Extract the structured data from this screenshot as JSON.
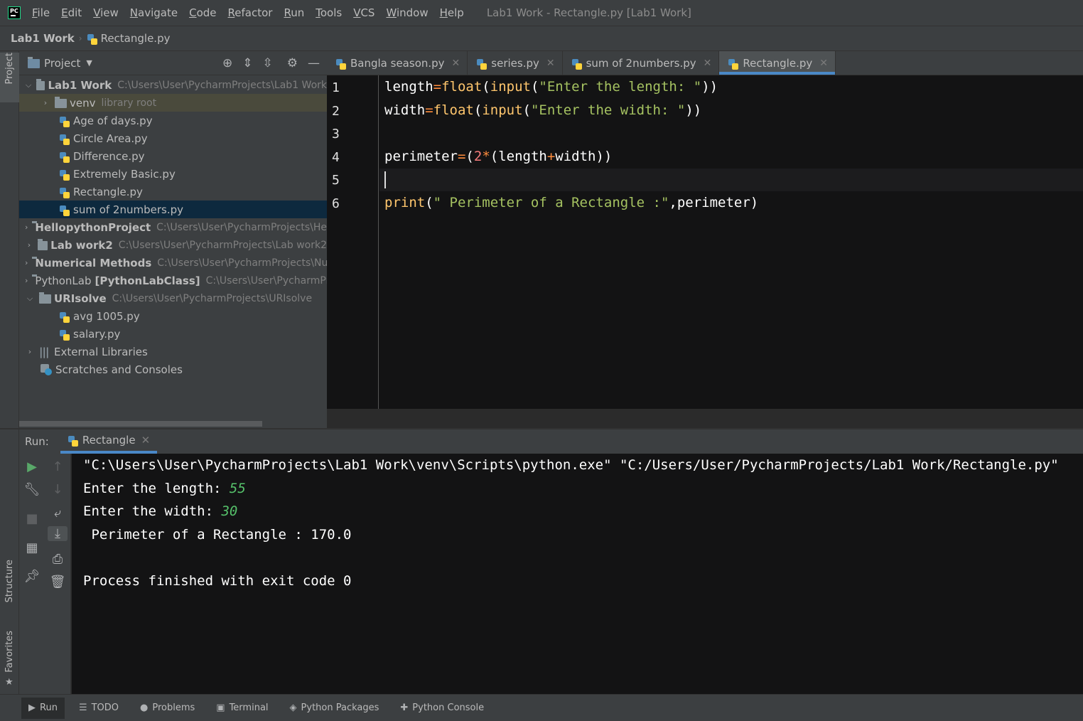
{
  "menu": {
    "items": [
      "File",
      "Edit",
      "View",
      "Navigate",
      "Code",
      "Refactor",
      "Run",
      "Tools",
      "VCS",
      "Window",
      "Help"
    ],
    "window_title": "Lab1 Work - Rectangle.py [Lab1 Work]"
  },
  "navbar": {
    "project": "Lab1 Work",
    "file": "Rectangle.py"
  },
  "left_stripe": {
    "project": "Project",
    "structure": "Structure",
    "favorites": "Favorites"
  },
  "project_panel": {
    "title": "Project",
    "tree": [
      {
        "name": "Lab1 Work",
        "path": "C:\\Users\\User\\PycharmProjects\\Lab1 Work",
        "type": "folder",
        "expanded": true,
        "bold": true
      },
      {
        "name": "venv",
        "path": "library root",
        "type": "folder",
        "collapsed": true
      },
      {
        "name": "Age of days.py",
        "type": "py"
      },
      {
        "name": "Circle Area.py",
        "type": "py"
      },
      {
        "name": "Difference.py",
        "type": "py"
      },
      {
        "name": "Extremely Basic.py",
        "type": "py"
      },
      {
        "name": "Rectangle.py",
        "type": "py"
      },
      {
        "name": "sum of 2numbers.py",
        "type": "py",
        "selected": true
      },
      {
        "name": "HellopythonProject",
        "path": "C:\\Users\\User\\PycharmProjects\\Hell",
        "type": "folder",
        "bold": true
      },
      {
        "name": "Lab work2",
        "path": "C:\\Users\\User\\PycharmProjects\\Lab work2",
        "type": "folder",
        "bold": true
      },
      {
        "name": "Numerical Methods",
        "path": "C:\\Users\\User\\PycharmProjects\\Nur",
        "type": "folder",
        "bold": true
      },
      {
        "name": "PythonLab",
        "extra": "[PythonLabClass]",
        "path": "C:\\Users\\User\\PycharmProj",
        "type": "folder"
      },
      {
        "name": "URIsolve",
        "path": "C:\\Users\\User\\PycharmProjects\\URIsolve",
        "type": "folder",
        "bold": true,
        "expanded": true
      },
      {
        "name": "avg 1005.py",
        "type": "py"
      },
      {
        "name": "salary.py",
        "type": "py"
      },
      {
        "name": "External Libraries",
        "type": "lib"
      },
      {
        "name": "Scratches and Consoles",
        "type": "scratch"
      }
    ]
  },
  "editor": {
    "tabs": [
      {
        "label": "Bangla season.py",
        "active": false
      },
      {
        "label": "series.py",
        "active": false
      },
      {
        "label": "sum of 2numbers.py",
        "active": false
      },
      {
        "label": "Rectangle.py",
        "active": true
      }
    ],
    "line_numbers": [
      "1",
      "2",
      "3",
      "4",
      "5",
      "6"
    ],
    "code": {
      "l1_var": "length",
      "l1_op": "=",
      "l1_fn": "float",
      "l1_p1": "(",
      "l1_fn2": "input",
      "l1_p2": "(",
      "l1_str": "\"Enter the length: \"",
      "l1_end": "))",
      "l2_var": "width",
      "l2_op": "=",
      "l2_fn": "float",
      "l2_p1": "(",
      "l2_fn2": "input",
      "l2_p2": "(",
      "l2_str": "\"Enter the width: \"",
      "l2_end": "))",
      "l4_var": "perimeter",
      "l4_op": "=",
      "l4_p1": "(",
      "l4_num": "2",
      "l4_mul": "*",
      "l4_p2": "(length",
      "l4_plus": "+",
      "l4_rest": "width))",
      "l6_fn": "print",
      "l6_p1": "(",
      "l6_str": "\" Perimeter of a Rectangle :\"",
      "l6_rest": ",perimeter)"
    }
  },
  "run_panel": {
    "label": "Run:",
    "tab": "Rectangle",
    "console": {
      "cmd": "\"C:\\Users\\User\\PycharmProjects\\Lab1 Work\\venv\\Scripts\\python.exe\" \"C:/Users/User/PycharmProjects/Lab1 Work/Rectangle.py\"",
      "prompt1": "Enter the length: ",
      "input1": "55",
      "prompt2": "Enter the width: ",
      "input2": "30",
      "result": " Perimeter of a Rectangle : 170.0",
      "exit": "Process finished with exit code 0"
    }
  },
  "bottom_bar": {
    "run": "Run",
    "todo": "TODO",
    "problems": "Problems",
    "terminal": "Terminal",
    "python_packages": "Python Packages",
    "python_console": "Python Console"
  },
  "colors": {
    "accent": "#4a88c7",
    "run_green": "#59a869",
    "string": "#a5c261",
    "function": "#ffc66d",
    "user_input": "#56c26b"
  }
}
